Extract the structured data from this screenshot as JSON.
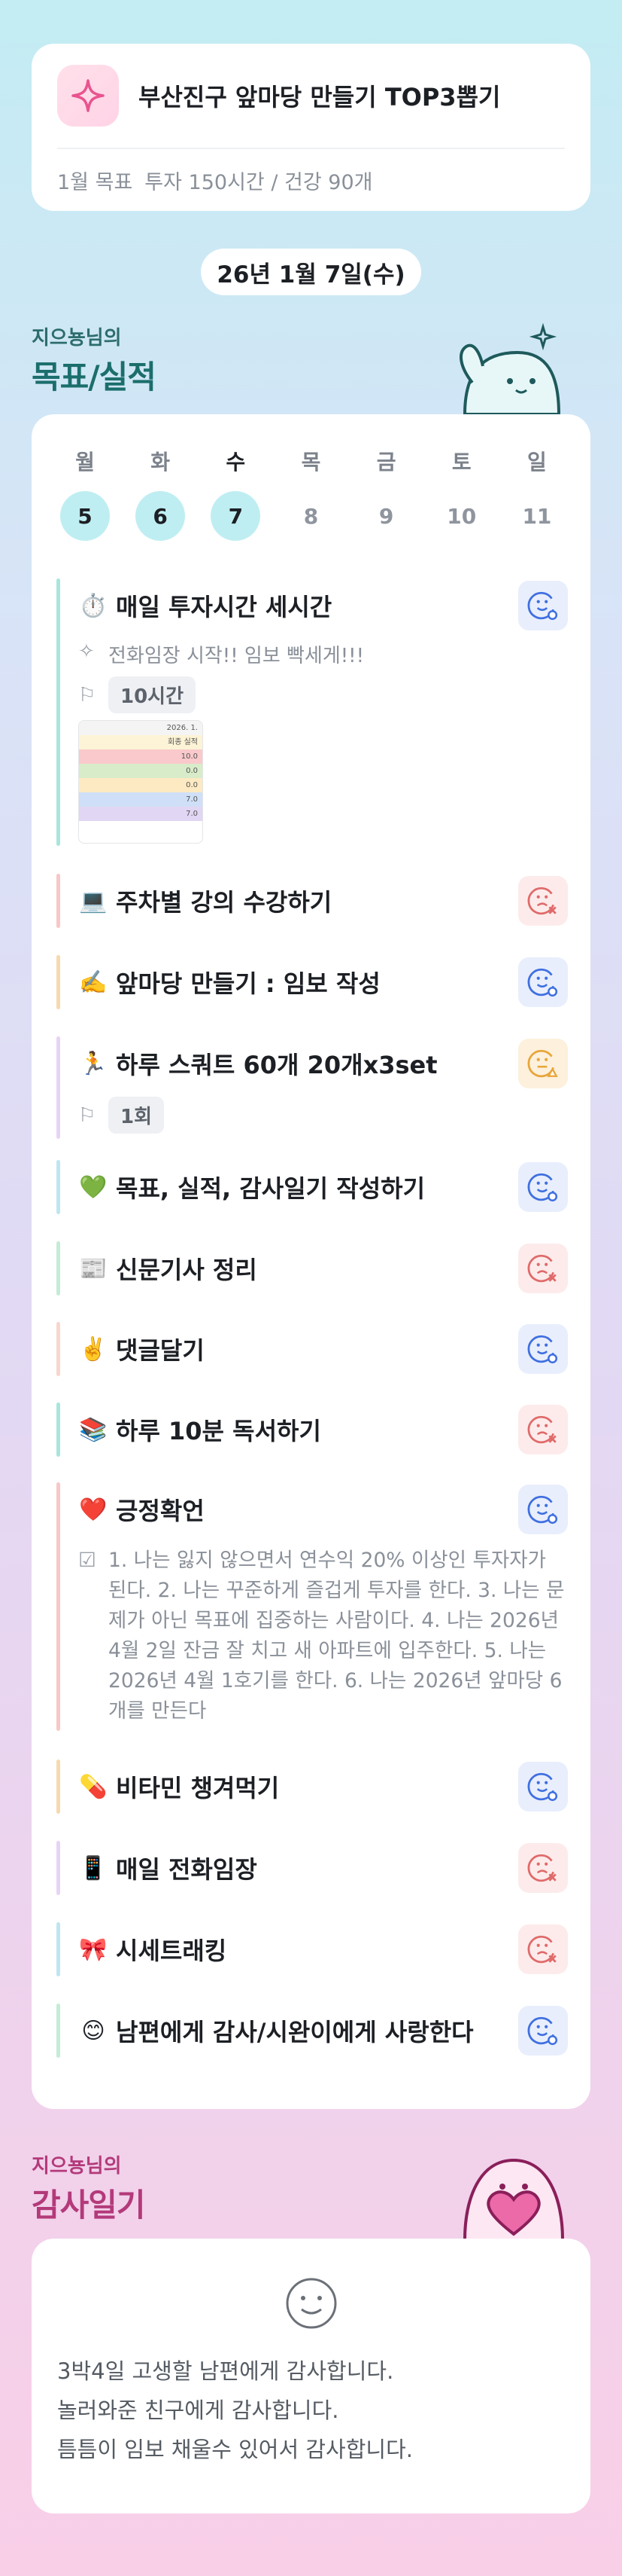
{
  "header": {
    "title": "부산진구 앞마당 만들기 TOP3뽑기",
    "goal_label": "1월 목표",
    "goal_text": "투자 150시간 / 건강 90개"
  },
  "date": "26년 1월 7일(수)",
  "goals_section": {
    "small": "지으뇽님의",
    "big": "목표/실적"
  },
  "week": [
    {
      "name": "월",
      "num": "5",
      "done": true
    },
    {
      "name": "화",
      "num": "6",
      "done": true
    },
    {
      "name": "수",
      "num": "7",
      "done": true,
      "today": true
    },
    {
      "name": "목",
      "num": "8",
      "done": false
    },
    {
      "name": "금",
      "num": "9",
      "done": false
    },
    {
      "name": "토",
      "num": "10",
      "done": false
    },
    {
      "name": "일",
      "num": "11",
      "done": false
    }
  ],
  "goals": [
    {
      "emoji": "⏱️",
      "label": "매일 투자시간 세시간",
      "mood": "happy",
      "note": "전화임장 시작!! 임보 빡세게!!!",
      "tag": "10시간",
      "thumb": [
        "2026. 1.",
        "회종 실적",
        "10.0",
        "0.0",
        "0.0",
        "7.0",
        "7.0"
      ]
    },
    {
      "emoji": "💻",
      "label": "주차별 강의 수강하기",
      "mood": "sad"
    },
    {
      "emoji": "✍️",
      "label": "앞마당 만들기 : 임보 작성",
      "mood": "happy"
    },
    {
      "emoji": "🏃",
      "label": "하루 스쿼트 60개 20개x3set",
      "mood": "meh",
      "tag": "1회"
    },
    {
      "emoji": "💚",
      "label": "목표, 실적, 감사일기 작성하기",
      "mood": "happy"
    },
    {
      "emoji": "📰",
      "label": "신문기사 정리",
      "mood": "sad"
    },
    {
      "emoji": "✌️",
      "label": "댓글달기",
      "mood": "happy"
    },
    {
      "emoji": "📚",
      "label": "하루 10분 독서하기",
      "mood": "sad"
    },
    {
      "emoji": "❤️",
      "label": "긍정확언",
      "mood": "happy",
      "note": "1. 나는 잃지 않으면서 연수익 20% 이상인 투자자가 된다. 2. 나는 꾸준하게 즐겁게 투자를 한다. 3. 나는 문제가 아닌 목표에 집중하는 사람이다. 4. 나는 2026년 4월 2일 잔금 잘 치고 새 아파트에 입주한다. 5. 나는 2026년 4월 1호기를 한다. 6. 나는 2026년 앞마당 6개를 만든다"
    },
    {
      "emoji": "💊",
      "label": "비타민 챙겨먹기",
      "mood": "happy"
    },
    {
      "emoji": "📱",
      "label": "매일 전화임장",
      "mood": "sad"
    },
    {
      "emoji": "🎀",
      "label": "시세트래킹",
      "mood": "sad"
    },
    {
      "emoji": "😊",
      "label": "남편에게 감사/시완이에게 사랑한다",
      "mood": "happy"
    }
  ],
  "gratitude_section": {
    "small": "지으뇽님의",
    "big": "감사일기"
  },
  "gratitude": {
    "lines": [
      "3박4일 고생할 남편에게 감사합니다.",
      "놀러와준 친구에게 감사합니다.",
      "틈틈이 임보 채울수 있어서 감사합니다."
    ]
  },
  "colors": {
    "happy": "#3f6fe0",
    "sad": "#e06a6a",
    "meh": "#e8a53a",
    "bars": [
      "#a9e5dc",
      "#f9c7c7",
      "#f7d9b0",
      "#e6d4f5",
      "#bfe6f0",
      "#c4ecd6",
      "#f9d6cc"
    ]
  }
}
